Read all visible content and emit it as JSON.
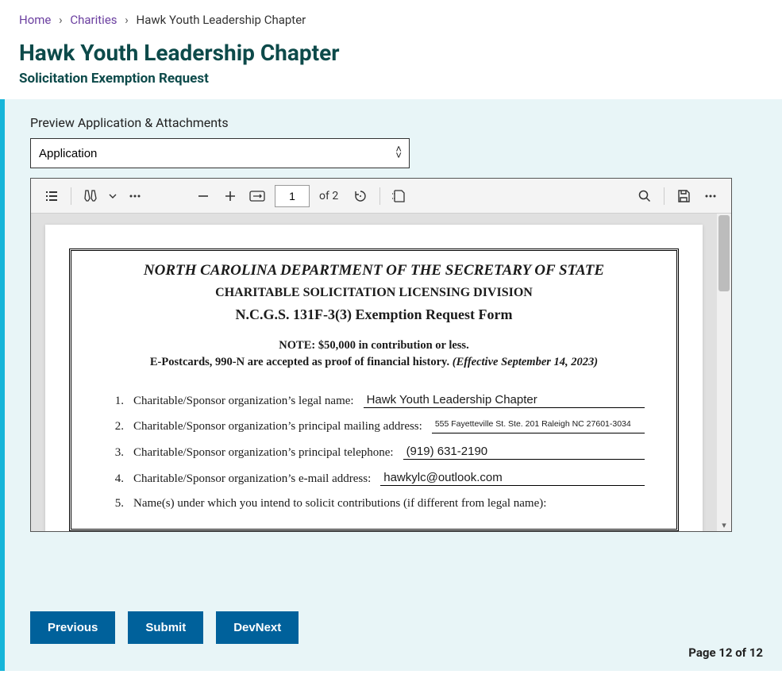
{
  "breadcrumb": {
    "home": "Home",
    "charities": "Charities",
    "current": "Hawk Youth Leadership Chapter"
  },
  "header": {
    "title": "Hawk Youth Leadership Chapter",
    "subtitle": "Solicitation Exemption Request"
  },
  "section": {
    "label": "Preview Application & Attachments",
    "select_value": "Application"
  },
  "pdf_toolbar": {
    "page_input": "1",
    "page_of": "of 2"
  },
  "document": {
    "h1": "NORTH CAROLINA DEPARTMENT OF THE SECRETARY OF STATE",
    "h2": "CHARITABLE SOLICITATION LICENSING DIVISION",
    "h3": "N.C.G.S. 131F-3(3) Exemption Request Form",
    "note1": "NOTE:  $50,000 in contribution or less.",
    "note2_bold": "E-Postcards, 990-N are accepted as proof of financial history. ",
    "note2_italic": "(Effective September 14, 2023)",
    "rows": [
      {
        "num": "1.",
        "label": "Charitable/Sponsor organization’s legal name:",
        "value": "Hawk Youth Leadership Chapter",
        "small": false
      },
      {
        "num": "2.",
        "label": "Charitable/Sponsor organization’s principal mailing address:",
        "value": "555 Fayetteville St. Ste. 201 Raleigh NC 27601-3034",
        "small": true
      },
      {
        "num": "3.",
        "label": "Charitable/Sponsor organization’s principal telephone:",
        "value": "(919) 631-2190",
        "small": false
      },
      {
        "num": "4.",
        "label": "Charitable/Sponsor organization’s e-mail address:",
        "value": "hawkylc@outlook.com",
        "small": false
      },
      {
        "num": "5.",
        "label": "Name(s) under which you intend to solicit contributions (if different from legal name):",
        "value": "",
        "small": false,
        "nofill": true
      }
    ]
  },
  "buttons": {
    "previous": "Previous",
    "submit": "Submit",
    "devnext": "DevNext"
  },
  "footer": {
    "page_indicator": "Page 12 of 12"
  }
}
